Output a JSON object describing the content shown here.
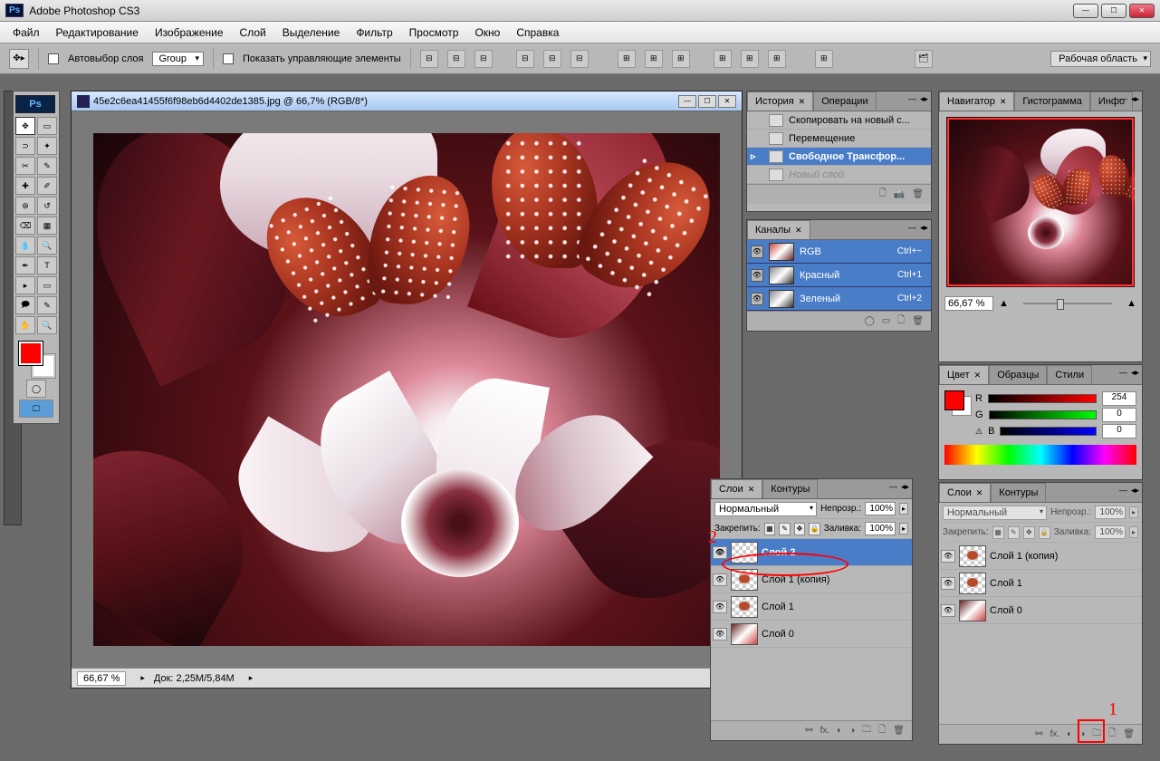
{
  "app": {
    "title": "Adobe Photoshop CS3",
    "badge": "Ps"
  },
  "menu": [
    "Файл",
    "Редактирование",
    "Изображение",
    "Слой",
    "Выделение",
    "Фильтр",
    "Просмотр",
    "Окно",
    "Справка"
  ],
  "options": {
    "auto_select": "Автовыбор слоя",
    "group": "Group",
    "show_transform": "Показать управляющие элементы",
    "workspace": "Рабочая область"
  },
  "document": {
    "title": "45e2c6ea41455f6f98eb6d4402de1385.jpg @ 66,7% (RGB/8*)",
    "zoom": "66,67 %",
    "docinfo": "Док: 2,25M/5,84M"
  },
  "history": {
    "tab1": "История",
    "tab2": "Операции",
    "items": [
      {
        "label": "Скопировать на новый с...",
        "state": "norm"
      },
      {
        "label": "Перемещение",
        "state": "norm"
      },
      {
        "label": "Свободное Трансфор...",
        "state": "sel"
      },
      {
        "label": "Новый слой",
        "state": "dim"
      }
    ]
  },
  "channels": {
    "tab": "Каналы",
    "items": [
      {
        "name": "RGB",
        "key": "Ctrl+~",
        "thumb": "color"
      },
      {
        "name": "Красный",
        "key": "Ctrl+1",
        "thumb": "bw"
      },
      {
        "name": "Зеленый",
        "key": "Ctrl+2",
        "thumb": "bw"
      }
    ]
  },
  "navigator": {
    "tab1": "Навигатор",
    "tab2": "Гистограмма",
    "tab3": "Инфо",
    "zoom": "66,67 %"
  },
  "color": {
    "tab1": "Цвет",
    "tab2": "Образцы",
    "tab3": "Стили",
    "r": "254",
    "g": "0",
    "b": "0"
  },
  "layers1": {
    "tab1": "Слои",
    "tab2": "Контуры",
    "blend": "Нормальный",
    "opacity_lbl": "Непрозр.:",
    "opacity": "100%",
    "lock_lbl": "Закрепить:",
    "fill_lbl": "Заливка:",
    "fill": "100%",
    "items": [
      {
        "name": "Слой 2",
        "sel": true,
        "thumb": "checker"
      },
      {
        "name": "Слой 1 (копия)",
        "sel": false,
        "thumb": "bf"
      },
      {
        "name": "Слой 1",
        "sel": false,
        "thumb": "bf"
      },
      {
        "name": "Слой 0",
        "sel": false,
        "thumb": "img"
      }
    ]
  },
  "layers2": {
    "tab1": "Слои",
    "tab2": "Контуры",
    "blend": "Нормальный",
    "opacity_lbl": "Непрозр.:",
    "opacity": "100%",
    "lock_lbl": "Закрепить:",
    "fill_lbl": "Заливка:",
    "fill": "100%",
    "items": [
      {
        "name": "Слой 1 (копия)",
        "thumb": "bf"
      },
      {
        "name": "Слой 1",
        "thumb": "bf"
      },
      {
        "name": "Слой 0",
        "thumb": "img"
      }
    ]
  },
  "annotations": {
    "n1": "1",
    "n2": "2"
  }
}
